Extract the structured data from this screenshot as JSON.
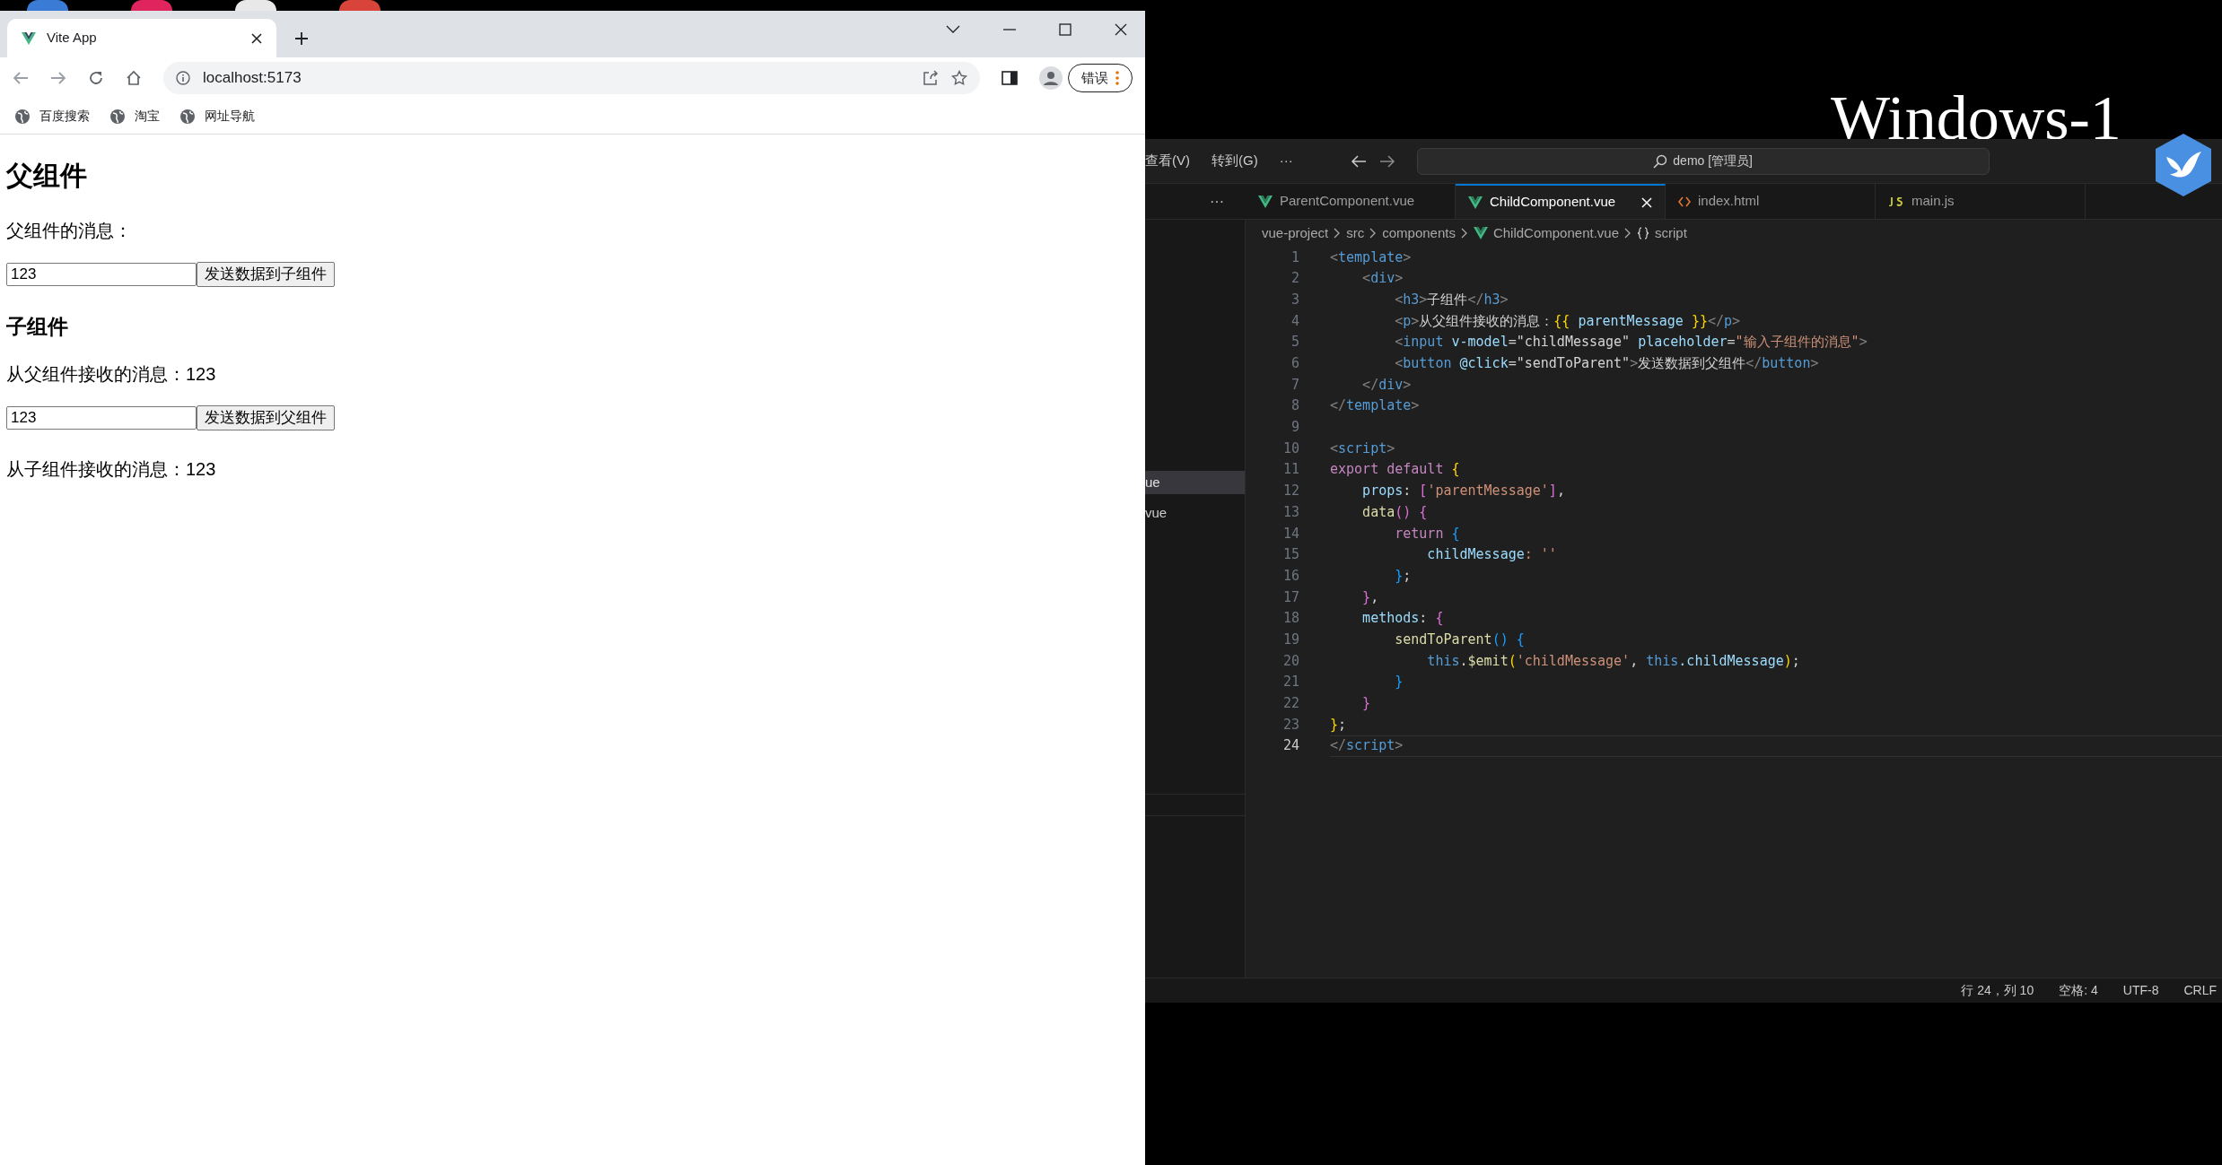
{
  "browser": {
    "tab": {
      "title": "Vite App",
      "selected": true
    },
    "address": "localhost:5173",
    "profile_button": "错误",
    "bookmarks": [
      "百度搜索",
      "淘宝",
      "网址导航"
    ],
    "page": [
      {
        "kind": "h2",
        "text": "父组件"
      },
      {
        "kind": "p",
        "text": "父组件的消息："
      },
      {
        "kind": "form",
        "value": "123",
        "button": "发送数据到子组件"
      },
      {
        "kind": "h3",
        "text": "子组件"
      },
      {
        "kind": "p",
        "text": "从父组件接收的消息：123"
      },
      {
        "kind": "form",
        "value": "123",
        "button": "发送数据到父组件"
      },
      {
        "kind": "p",
        "text": "从子组件接收的消息：123"
      }
    ]
  },
  "desktop": {
    "label": "Windows-1"
  },
  "editor": {
    "menu": [
      "查看(V)",
      "转到(G)",
      "···"
    ],
    "command_center": "demo [管理员]",
    "sidebar_items": [
      {
        "text": "ue",
        "selected": true
      },
      {
        "text": "vue",
        "selected": false
      }
    ],
    "more": "···",
    "tabs": [
      {
        "label": "ParentComponent.vue",
        "kind": "vue",
        "selected": false
      },
      {
        "label": "ChildComponent.vue",
        "kind": "vue",
        "selected": true
      },
      {
        "label": "index.html",
        "kind": "html",
        "selected": false
      },
      {
        "label": "main.js",
        "kind": "js",
        "selected": false
      }
    ],
    "breadcrumb": [
      {
        "text": "vue-project",
        "kind": "folder"
      },
      {
        "text": "src",
        "kind": "folder"
      },
      {
        "text": "components",
        "kind": "folder"
      },
      {
        "text": "ChildComponent.vue",
        "kind": "vue"
      },
      {
        "text": "script",
        "kind": "symbol"
      }
    ],
    "lines": [
      {
        "n": "1",
        "tokens": [
          {
            "text": "<",
            "color": "#808080"
          },
          {
            "text": "template",
            "color": "#569cd6"
          },
          {
            "text": ">",
            "color": "#808080"
          }
        ]
      },
      {
        "n": "2",
        "tokens": [
          {
            "text": "    <",
            "color": "#808080"
          },
          {
            "text": "div",
            "color": "#569cd6"
          },
          {
            "text": ">",
            "color": "#808080"
          }
        ]
      },
      {
        "n": "3",
        "tokens": [
          {
            "text": "        <",
            "color": "#808080"
          },
          {
            "text": "h3",
            "color": "#569cd6"
          },
          {
            "text": ">",
            "color": "#808080"
          },
          {
            "text": "子组件",
            "color": "#d4d4d4"
          },
          {
            "text": "</",
            "color": "#808080"
          },
          {
            "text": "h3",
            "color": "#569cd6"
          },
          {
            "text": ">",
            "color": "#808080"
          }
        ]
      },
      {
        "n": "4",
        "tokens": [
          {
            "text": "        <",
            "color": "#808080"
          },
          {
            "text": "p",
            "color": "#569cd6"
          },
          {
            "text": ">",
            "color": "#808080"
          },
          {
            "text": "从父组件接收的消息：",
            "color": "#d4d4d4"
          },
          {
            "text": "{{",
            "color": "#ffd700"
          },
          {
            "text": " parentMessage ",
            "color": "#9cdcfe"
          },
          {
            "text": "}}",
            "color": "#ffd700"
          },
          {
            "text": "</",
            "color": "#808080"
          },
          {
            "text": "p",
            "color": "#569cd6"
          },
          {
            "text": ">",
            "color": "#808080"
          }
        ]
      },
      {
        "n": "5",
        "tokens": [
          {
            "text": "        <",
            "color": "#808080"
          },
          {
            "text": "input",
            "color": "#569cd6"
          },
          {
            "text": " v-model",
            "color": "#9cdcfe"
          },
          {
            "text": "=\"childMessage\"",
            "color": "#d4d4d4"
          },
          {
            "text": " placeholder",
            "color": "#9cdcfe"
          },
          {
            "text": "=",
            "color": "#d4d4d4"
          },
          {
            "text": "\"输入子组件的消息\"",
            "color": "#ce9178"
          },
          {
            "text": ">",
            "color": "#808080"
          }
        ]
      },
      {
        "n": "6",
        "tokens": [
          {
            "text": "        <",
            "color": "#808080"
          },
          {
            "text": "button",
            "color": "#569cd6"
          },
          {
            "text": " @click",
            "color": "#9cdcfe"
          },
          {
            "text": "=\"sendToParent\"",
            "color": "#d4d4d4"
          },
          {
            "text": ">",
            "color": "#808080"
          },
          {
            "text": "发送数据到父组件",
            "color": "#d4d4d4"
          },
          {
            "text": "</",
            "color": "#808080"
          },
          {
            "text": "button",
            "color": "#569cd6"
          },
          {
            "text": ">",
            "color": "#808080"
          }
        ]
      },
      {
        "n": "7",
        "tokens": [
          {
            "text": "    </",
            "color": "#808080"
          },
          {
            "text": "div",
            "color": "#569cd6"
          },
          {
            "text": ">",
            "color": "#808080"
          }
        ]
      },
      {
        "n": "8",
        "tokens": [
          {
            "text": "</",
            "color": "#808080"
          },
          {
            "text": "template",
            "color": "#569cd6"
          },
          {
            "text": ">",
            "color": "#808080"
          }
        ]
      },
      {
        "n": "9"
      },
      {
        "n": "10",
        "tokens": [
          {
            "text": "<",
            "color": "#808080"
          },
          {
            "text": "script",
            "color": "#569cd6"
          },
          {
            "text": ">",
            "color": "#808080"
          }
        ]
      },
      {
        "n": "11",
        "tokens": [
          {
            "text": "export default",
            "color": "#c586c0"
          },
          {
            "text": " {",
            "color": "#ffd700"
          }
        ]
      },
      {
        "n": "12",
        "tokens": [
          {
            "text": "    props",
            "color": "#9cdcfe"
          },
          {
            "text": ":",
            "color": "#d4d4d4"
          },
          {
            "text": " [",
            "color": "#da70d6"
          },
          {
            "text": "'parentMessage'",
            "color": "#ce9178"
          },
          {
            "text": "]",
            "color": "#da70d6"
          },
          {
            "text": ",",
            "color": "#d4d4d4"
          }
        ]
      },
      {
        "n": "13",
        "tokens": [
          {
            "text": "    data",
            "color": "#dcdcaa"
          },
          {
            "text": "() {",
            "color": "#da70d6"
          }
        ]
      },
      {
        "n": "14",
        "tokens": [
          {
            "text": "        return",
            "color": "#c586c0"
          },
          {
            "text": " {",
            "color": "#179fff"
          }
        ]
      },
      {
        "n": "15",
        "tokens": [
          {
            "text": "            childMessage",
            "color": "#9cdcfe"
          },
          {
            "text": ": ''",
            "color": "#ce9178"
          }
        ]
      },
      {
        "n": "16",
        "tokens": [
          {
            "text": "        }",
            "color": "#179fff"
          },
          {
            "text": ";",
            "color": "#d4d4d4"
          }
        ]
      },
      {
        "n": "17",
        "tokens": [
          {
            "text": "    }",
            "color": "#da70d6"
          },
          {
            "text": ",",
            "color": "#d4d4d4"
          }
        ]
      },
      {
        "n": "18",
        "tokens": [
          {
            "text": "    methods",
            "color": "#9cdcfe"
          },
          {
            "text": ":",
            "color": "#d4d4d4"
          },
          {
            "text": " {",
            "color": "#da70d6"
          }
        ]
      },
      {
        "n": "19",
        "tokens": [
          {
            "text": "        sendToParent",
            "color": "#dcdcaa"
          },
          {
            "text": "() {",
            "color": "#179fff"
          }
        ]
      },
      {
        "n": "20",
        "tokens": [
          {
            "text": "            this",
            "color": "#569cd6"
          },
          {
            "text": ".",
            "color": "#d4d4d4"
          },
          {
            "text": "$emit",
            "color": "#dcdcaa"
          },
          {
            "text": "(",
            "color": "#ffd700"
          },
          {
            "text": "'childMessage'",
            "color": "#ce9178"
          },
          {
            "text": ",",
            "color": "#d4d4d4"
          },
          {
            "text": " this",
            "color": "#569cd6"
          },
          {
            "text": ".childMessage",
            "color": "#9cdcfe"
          },
          {
            "text": ")",
            "color": "#ffd700"
          },
          {
            "text": ";",
            "color": "#d4d4d4"
          }
        ]
      },
      {
        "n": "21",
        "tokens": [
          {
            "text": "        }",
            "color": "#179fff"
          }
        ]
      },
      {
        "n": "22",
        "tokens": [
          {
            "text": "    }",
            "color": "#da70d6"
          }
        ]
      },
      {
        "n": "23",
        "tokens": [
          {
            "text": "}",
            "color": "#ffd700"
          },
          {
            "text": ";",
            "color": "#d4d4d4"
          }
        ]
      },
      {
        "n": "24",
        "current": true,
        "tokens": [
          {
            "text": "</",
            "color": "#808080"
          },
          {
            "text": "script",
            "color": "#569cd6"
          },
          {
            "text": ">",
            "color": "#808080"
          }
        ]
      }
    ],
    "status": [
      "行 24，列 10",
      "空格: 4",
      "UTF-8",
      "CRLF"
    ]
  }
}
